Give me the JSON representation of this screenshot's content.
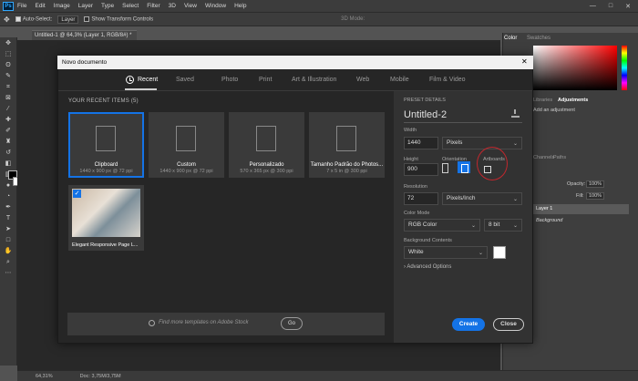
{
  "menu": {
    "logo": "Ps",
    "items": [
      "File",
      "Edit",
      "Image",
      "Layer",
      "Type",
      "Select",
      "Filter",
      "3D",
      "View",
      "Window",
      "Help"
    ],
    "window_controls": [
      "—",
      "□",
      "✕"
    ]
  },
  "options": {
    "auto_select_label": "Auto-Select:",
    "auto_select_value": "Layer",
    "transform_label": "Show Transform Controls",
    "mode_label": "3D Mode:"
  },
  "document_tab": "Untitled-1 @ 64,3% (Layer 1, RGB/8#) *",
  "right_panels": {
    "color_tab": "Color",
    "swatches_tab": "Swatches",
    "libraries_tab": "Libraries",
    "adjustments_tab": "Adjustments",
    "adjustments_label": "Add an adjustment",
    "channels_tab": "Channels",
    "paths_tab": "Paths",
    "opacity_label": "Opacity:",
    "opacity_value": "100%",
    "fill_label": "Fill:",
    "fill_value": "100%",
    "layers": [
      "Layer 1",
      "Background"
    ]
  },
  "status": {
    "zoom": "64,31%",
    "doc": "Doc: 3,75M/3,75M"
  },
  "dialog": {
    "title": "Novo documento",
    "close": "✕",
    "tabs": [
      "Recent",
      "Saved",
      "Photo",
      "Print",
      "Art & Illustration",
      "Web",
      "Mobile",
      "Film & Video"
    ],
    "recent_title": "YOUR RECENT ITEMS  (5)",
    "items": [
      {
        "name": "Clipboard",
        "dims": "1440 x 900 px @ 72 ppi"
      },
      {
        "name": "Custom",
        "dims": "1440 x 900 px @ 72 ppi"
      },
      {
        "name": "Personalizado",
        "dims": "570 x 365 px @ 300 ppi"
      },
      {
        "name": "Tamanho Padrão do Photos...",
        "dims": "7 x 5 in @ 300 ppi"
      },
      {
        "name": "Elegant Responsive Page L...",
        "dims": ""
      }
    ],
    "search_placeholder": "Find more templates on Adobe Stock",
    "go_label": "Go",
    "preset": {
      "section_title": "PRESET DETAILS",
      "name": "Untitled-2",
      "width_label": "Width",
      "width_value": "1440",
      "width_unit": "Pixels",
      "height_label": "Height",
      "height_value": "900",
      "orientation_label": "Orientation",
      "artboards_label": "Artboards",
      "resolution_label": "Resolution",
      "resolution_value": "72",
      "resolution_unit": "Pixels/Inch",
      "color_mode_label": "Color Mode",
      "color_mode_value": "RGB Color",
      "bit_depth": "8 bit",
      "bg_contents_label": "Background Contents",
      "bg_contents_value": "White",
      "advanced_label": "Advanced Options"
    },
    "create_label": "Create",
    "close_label": "Close"
  },
  "colors": {
    "accent": "#1473e6",
    "highlight_circle": "#c1272d"
  }
}
